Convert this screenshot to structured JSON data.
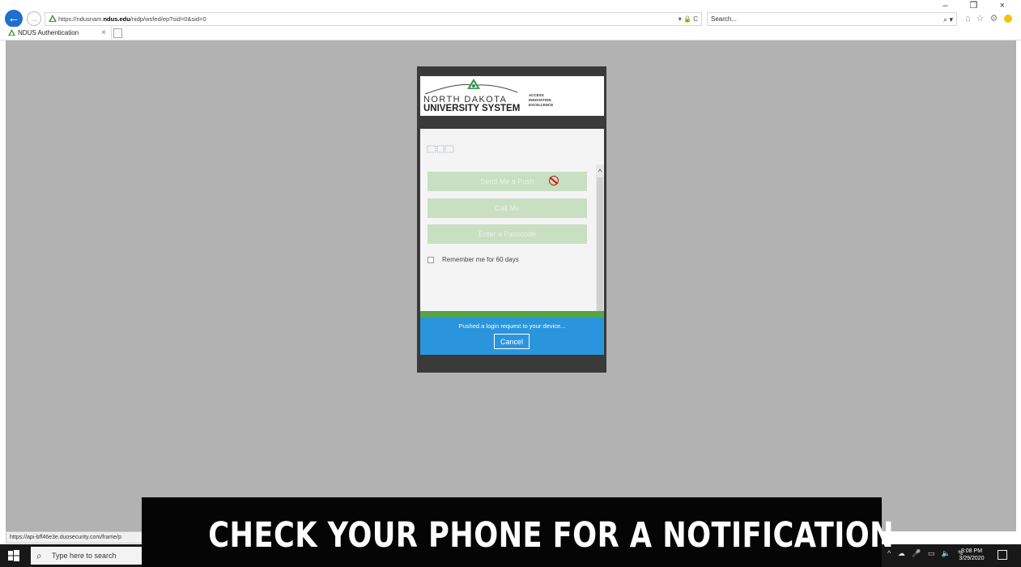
{
  "browser": {
    "url_prefix": "https://ndusnam.",
    "url_domain": "ndus.edu",
    "url_suffix": "/nidp/wsfed/ep?sid=0&sid=0",
    "address_controls": "▾ 🔒 C",
    "search_placeholder": "Search...",
    "search_icon": "⌕ ▾",
    "toolbar_icons": "⌂ ☆ ⚙",
    "window_controls": "– ❐ ×",
    "tab_title": "NDUS Authentication",
    "tab_close": "×"
  },
  "branding": {
    "name_line1": "NORTH DAKOTA",
    "name_line2": "UNIVERSITY SYSTEM",
    "tagline": [
      "ACCESS",
      "INNOVATION",
      "EXCELLENCE"
    ]
  },
  "duo": {
    "buttons": {
      "send_push": "Send Me a Push",
      "call_me": "Call Me",
      "passcode": "Enter a Passcode"
    },
    "remember_label": "Remember me for 60 days",
    "status_text": "Pushed a login request to your device...",
    "cancel_label": "Cancel",
    "scroll_up": "^"
  },
  "status_url": "https://api-bff46e3e.duosecurity.com/frame/p",
  "taskbar": {
    "search_placeholder": "Type here to search",
    "tray_icons": "^ ☁ 🎤 ▭ 🔈 ✎",
    "time": "8:08 PM",
    "date": "3/29/2020"
  },
  "caption": "CHECK YOUR PHONE FOR A NOTIFICATION",
  "colors": {
    "page_bg": "#b2b2b2",
    "push_bar": "#2a95dd",
    "success_strip": "#53a448",
    "button_disabled": "#c8dfc1"
  }
}
